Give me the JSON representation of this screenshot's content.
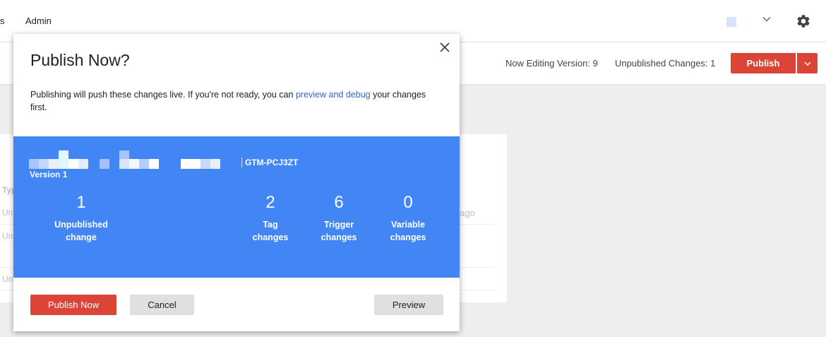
{
  "topbar": {
    "nav_cut_label": "s",
    "admin_label": "Admin"
  },
  "workspace": {
    "now_editing": "Now Editing Version: 9",
    "unpublished": "Unpublished Changes: 1",
    "publish_label": "Publish"
  },
  "background": {
    "col_header": "Typ",
    "rows": [
      "Un",
      "Un",
      "Un"
    ],
    "time_fragment": "ago"
  },
  "modal": {
    "title": "Publish Now?",
    "desc_before": "Publishing will push these changes live. If you're not ready, you can ",
    "desc_link": "preview and debug",
    "desc_after": " your changes first.",
    "container_id": "GTM-PCJ3ZT",
    "version_label": "Version 1",
    "stats": [
      {
        "value": "1",
        "label": "Unpublished change"
      },
      {
        "value": "2",
        "label": "Tag changes"
      },
      {
        "value": "6",
        "label": "Trigger changes"
      },
      {
        "value": "0",
        "label": "Variable changes"
      }
    ],
    "publish_now_label": "Publish Now",
    "cancel_label": "Cancel",
    "preview_label": "Preview"
  },
  "colors": {
    "accent_red": "#db4437",
    "summary_blue": "#4285f4",
    "link_blue": "#3367d6"
  }
}
